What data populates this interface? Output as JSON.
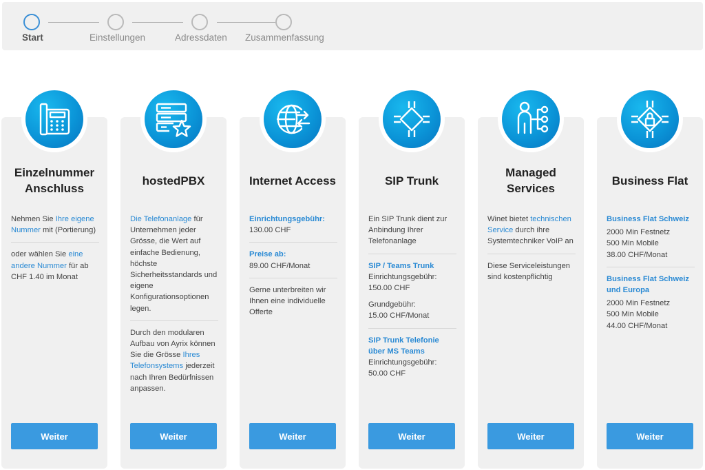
{
  "stepper": {
    "steps": [
      {
        "label": "Start",
        "active": true
      },
      {
        "label": "Einstellungen",
        "active": false
      },
      {
        "label": "Adressdaten",
        "active": false
      },
      {
        "label": "Zusammenfassung",
        "active": false
      }
    ]
  },
  "cards": [
    {
      "icon": "desk-phone-icon",
      "title": "Einzelnummer Anschluss",
      "button": "Weiter"
    },
    {
      "icon": "server-star-icon",
      "title": "hostedPBX",
      "button": "Weiter"
    },
    {
      "icon": "globe-arrows-icon",
      "title": "Internet Access",
      "button": "Weiter"
    },
    {
      "icon": "chip-icon",
      "title": "SIP Trunk",
      "button": "Weiter"
    },
    {
      "icon": "person-network-icon",
      "title": "Managed Services",
      "button": "Weiter"
    },
    {
      "icon": "chip-lock-icon",
      "title": "Business Flat",
      "button": "Weiter"
    }
  ],
  "content": {
    "c1": {
      "t1": "Nehmen Sie ",
      "l1": "Ihre eigene Nummer",
      "t2": " mit (Portierung)",
      "t3": "oder wählen Sie ",
      "l2": "eine andere Nummer",
      "t4": " für ab CHF 1.40 im Monat"
    },
    "c2": {
      "l1": "Die Telefonanlage",
      "t1": " für Unternehmen jeder Grösse, die Wert auf einfache Bedienung, höchste Sicherheitsstandards und eigene Konfigurationsoptionen legen.",
      "t2": "Durch den modularen Aufbau von Ayrix können Sie die Grösse ",
      "l2": "Ihres Telefonsystems",
      "t3": " jederzeit nach Ihren Bedürfnissen anpassen."
    },
    "c3": {
      "h1": "Einrichtungsgebühr:",
      "v1": "130.00 CHF",
      "h2": "Preise ab:",
      "v2": "89.00 CHF/Monat",
      "t1": "Gerne unterbreiten wir Ihnen eine individuelle Offerte"
    },
    "c4": {
      "t1": "Ein SIP Trunk dient zur Anbindung Ihrer Telefonanlage",
      "h1": "SIP / Teams Trunk",
      "k1": "Einrichtungsgebühr:",
      "v1": "150.00 CHF",
      "k2": "Grundgebühr:",
      "v2": "15.00 CHF/Monat",
      "h2": "SIP Trunk Telefonie über MS Teams",
      "k3": "Einrichtungsgebühr:",
      "v3": "50.00 CHF"
    },
    "c5": {
      "t1": "Winet bietet ",
      "l1": "technischen Service",
      "t2": " durch ihre Systemtechniker VoIP an",
      "t3": "Diese Serviceleistungen sind kostenpflichtig"
    },
    "c6": {
      "h1": "Business Flat Schweiz",
      "a1": "2000 Min Festnetz",
      "a2": "500 Min Mobile",
      "a3": "38.00 CHF/Monat",
      "h2": "Business Flat Schweiz und Europa",
      "b1": "2000 Min Festnetz",
      "b2": "500 Min Mobile",
      "b3": "44.00 CHF/Monat"
    }
  },
  "colors": {
    "accent": "#3a9ae0",
    "link": "#2a8ad4",
    "card_bg": "#f0f0f0"
  }
}
